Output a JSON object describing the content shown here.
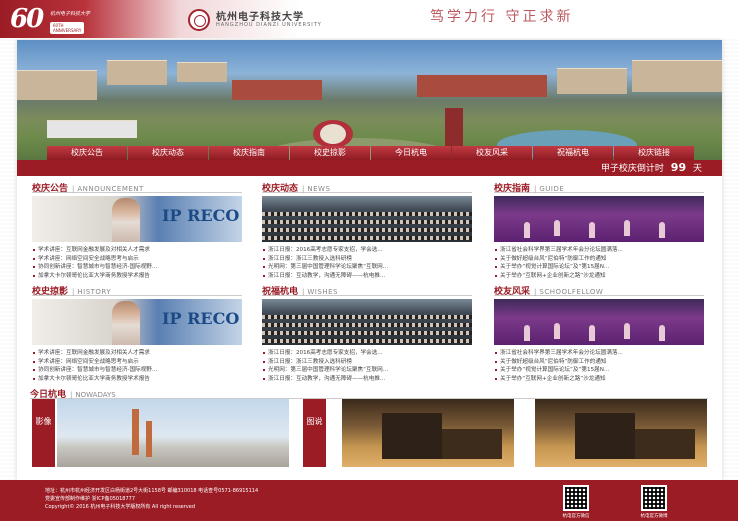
{
  "header": {
    "logo_number": "60",
    "logo_script": "杭州电子科技大学",
    "logo_tag": "60TH ANNIVERSARY",
    "uni_name_cn": "杭州电子科技大学",
    "uni_name_en": "HANGZHOU DIANZI UNIVERSITY",
    "motto": "笃学力行 守正求新"
  },
  "nav": {
    "items": [
      "校庆公告",
      "校庆动态",
      "校庆指南",
      "校史掠影",
      "今日杭电",
      "校友风采",
      "祝福杭电",
      "校庆链接"
    ]
  },
  "countdown": {
    "label": "甲子校庆倒计时",
    "days": "99",
    "unit": "天"
  },
  "sections": [
    {
      "title": "校庆公告",
      "en": "ANNOUNCEMENT",
      "items": [
        "学术讲座：互联网金融发展及对相关人才需求",
        "学术讲座：网络空间安全战略思考与启示",
        "协同创新讲座：智慧城市与智慧经济-国际视野...",
        "加拿大卡尔顿哥伦比亚大学商务教授学术报告"
      ]
    },
    {
      "title": "校庆动态",
      "en": "NEWS",
      "items": [
        "浙江日报：2016高考志愿专家支招，学会选...",
        "浙江日报：浙江三教授入选科研榜",
        "光明网：第三届中国管理科学论坛聚焦“互联网...",
        "浙江日报：互动教学，沟通无障碍——杭电推..."
      ]
    },
    {
      "title": "校庆指南",
      "en": "GUIDE",
      "items": [
        "浙江省社会科学界第三届学术年会分论坛圆满落...",
        "关于做好超级台风“尼伯特”防御工作的通知",
        "关于举办“视觉计算国际论坛”及“第15届N...",
        "关于举办“互联网+企业创新之路”沙龙通知"
      ]
    },
    {
      "title": "校史掠影",
      "en": "HISTORY",
      "items": [
        "学术讲座：互联网金融发展及对相关人才需求",
        "学术讲座：网络空间安全战略思考与启示",
        "协同创新讲座：智慧城市与智慧经济-国际视野...",
        "加拿大卡尔顿哥伦比亚大学商务教授学术报告"
      ]
    },
    {
      "title": "祝福杭电",
      "en": "WISHES",
      "items": [
        "浙江日报：2016高考志愿专家支招，学会选...",
        "浙江日报：浙江三教授入选科研榜",
        "光明网：第三届中国管理科学论坛聚焦“互联网...",
        "浙江日报：互动教学，沟通无障碍——杭电推..."
      ]
    },
    {
      "title": "校友风采",
      "en": "SCHOOLFELLOW",
      "items": [
        "浙江省社会科学界第三届学术年会分论坛圆满落...",
        "关于做好超级台风“尼伯特”防御工作的通知",
        "关于举办“视觉计算国际论坛”及“第15届N...",
        "关于举办“互联网+企业创新之路”沙龙通知"
      ]
    }
  ],
  "today": {
    "title": "今日杭电",
    "en": "NOWADAYS",
    "tab1": "影像",
    "tab2": "图说",
    "img_text": "IP RECO"
  },
  "footer": {
    "line1": "地址：杭州市杭州经济开发区白杨街道2号大街1158号  邮编310018  电话查号0571-86915114",
    "line2": "党委宣传部制作维护  浙ICP备05018777",
    "line3": "Copyright© 2016 杭州电子科技大学版权所有 All right reserved",
    "qr1_caption": "杭电官方微信",
    "qr2_caption": "杭电官方微博"
  }
}
